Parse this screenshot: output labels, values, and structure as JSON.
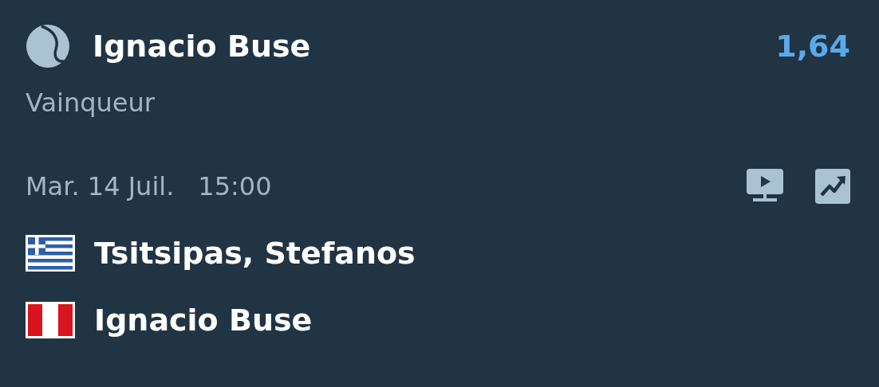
{
  "selection": {
    "name": "Ignacio Buse",
    "odds": "1,64",
    "market": "Vainqueur"
  },
  "event": {
    "date": "Mar. 14 Juil.",
    "time": "15:00"
  },
  "players": [
    {
      "name": "Tsitsipas, Stefanos",
      "kind": "greece"
    },
    {
      "name": "Ignacio Buse",
      "kind": "peru"
    }
  ]
}
